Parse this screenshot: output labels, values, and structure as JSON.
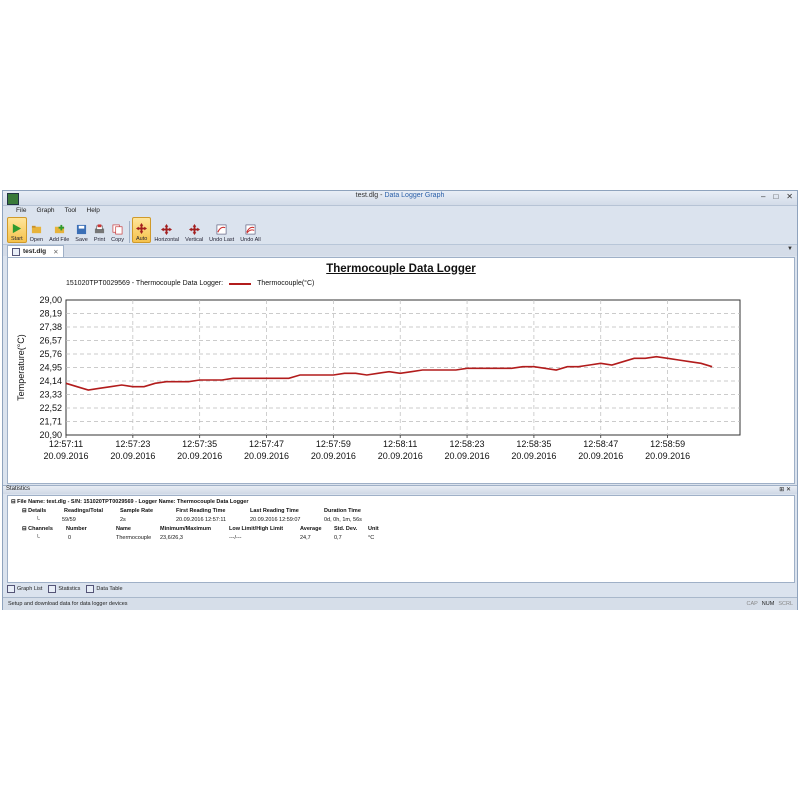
{
  "window": {
    "file_name": "test.dlg",
    "separator": " - ",
    "app_name": "Data Logger Graph",
    "controls": [
      "–",
      "□",
      "✕"
    ]
  },
  "menu": [
    "File",
    "Graph",
    "Tool",
    "Help"
  ],
  "toolbar": {
    "group1": [
      {
        "label": "Start",
        "icon": "play-icon"
      },
      {
        "label": "Open",
        "icon": "folder-open-icon"
      },
      {
        "label": "Add File",
        "icon": "add-file-icon"
      },
      {
        "label": "Save",
        "icon": "save-icon"
      },
      {
        "label": "Print",
        "icon": "print-icon"
      },
      {
        "label": "Copy",
        "icon": "copy-icon"
      }
    ],
    "group2": [
      {
        "label": "Auto",
        "icon": "move-auto-icon"
      },
      {
        "label": "Horizontal",
        "icon": "move-horizontal-icon"
      },
      {
        "label": "Vertical",
        "icon": "move-vertical-icon"
      },
      {
        "label": "Undo Last",
        "icon": "undo-last-icon"
      },
      {
        "label": "Undo All",
        "icon": "undo-all-icon"
      }
    ]
  },
  "document_tab": {
    "label": "test.dlg",
    "close": "✕"
  },
  "chart_data": {
    "type": "line",
    "title": "Thermocouple Data Logger",
    "subtitle": "151020TPT0029569 - Thermocouple Data Logger:",
    "legend": "Thermocouple(°C)",
    "ylabel": "Temperature(°C)",
    "xlabel": "",
    "ylim": [
      20.9,
      29.0
    ],
    "y_ticks": [
      "29,00",
      "28,19",
      "27,38",
      "26,57",
      "25,76",
      "24,95",
      "24,14",
      "23,33",
      "22,52",
      "21,71",
      "20,90"
    ],
    "x_ticks": [
      {
        "time": "12:57:11",
        "date": "20.09.2016"
      },
      {
        "time": "12:57:23",
        "date": "20.09.2016"
      },
      {
        "time": "12:57:35",
        "date": "20.09.2016"
      },
      {
        "time": "12:57:47",
        "date": "20.09.2016"
      },
      {
        "time": "12:57:59",
        "date": "20.09.2016"
      },
      {
        "time": "12:58:11",
        "date": "20.09.2016"
      },
      {
        "time": "12:58:23",
        "date": "20.09.2016"
      },
      {
        "time": "12:58:35",
        "date": "20.09.2016"
      },
      {
        "time": "12:58:47",
        "date": "20.09.2016"
      },
      {
        "time": "12:58:59",
        "date": "20.09.2016"
      }
    ],
    "xlim_seconds": [
      0,
      116
    ],
    "x_seconds": [
      0,
      2,
      4,
      6,
      8,
      10,
      12,
      14,
      16,
      18,
      20,
      22,
      24,
      26,
      28,
      30,
      32,
      34,
      36,
      38,
      40,
      42,
      44,
      46,
      48,
      50,
      52,
      54,
      56,
      58,
      60,
      62,
      64,
      66,
      68,
      70,
      72,
      74,
      76,
      78,
      80,
      82,
      84,
      86,
      88,
      90,
      92,
      94,
      96,
      98,
      100,
      102,
      104,
      106,
      108,
      110,
      112,
      114,
      116
    ],
    "values": [
      24.0,
      23.8,
      23.6,
      23.7,
      23.8,
      23.9,
      23.8,
      23.8,
      24.0,
      24.1,
      24.1,
      24.1,
      24.2,
      24.2,
      24.2,
      24.3,
      24.3,
      24.3,
      24.3,
      24.3,
      24.3,
      24.5,
      24.5,
      24.5,
      24.5,
      24.6,
      24.6,
      24.5,
      24.6,
      24.7,
      24.6,
      24.7,
      24.8,
      24.8,
      24.8,
      24.8,
      24.9,
      24.9,
      24.9,
      24.9,
      24.9,
      25.0,
      25.0,
      24.9,
      24.8,
      25.0,
      25.0,
      25.1,
      25.2,
      25.1,
      25.3,
      25.5,
      25.5,
      25.6,
      25.5,
      25.4,
      25.3,
      25.2,
      25.0
    ],
    "grid": true,
    "line_color": "#b21c1c"
  },
  "stats_panel": {
    "title": "Statistics",
    "pin": "⊞ ✕",
    "file_line": "File Name: test.dlg - S/N: 151020TPT0029569 - Logger Name: Thermocouple Data Logger",
    "details_label": "Details",
    "details_headers": [
      "Readings/Total",
      "Sample Rate",
      "First Reading Time",
      "Last Reading Time",
      "Duration Time"
    ],
    "details_values": [
      "59/59",
      "2s",
      "20.09.2016 12:57:11",
      "20.09.2016 12:59:07",
      "0d, 0h, 1m, 56s"
    ],
    "channels_label": "Channels",
    "channels_headers": [
      "Number",
      "Name",
      "Minimum/Maximum",
      "Low Limit/High Limit",
      "Average",
      "Std. Dev.",
      "Unit"
    ],
    "channels_values": [
      "0",
      "Thermocouple",
      "23,6/26,3",
      "---/---",
      "24,7",
      "0,7",
      "°C"
    ]
  },
  "bottom_tabs": [
    "Graph List",
    "Statistics",
    "Data Table"
  ],
  "status": {
    "text": "Setup and download data for data logger devices",
    "indicators": [
      "CAP",
      "NUM",
      "SCRL"
    ]
  },
  "colors": {
    "accent": "#f5c24c",
    "series": "#b21c1c",
    "chrome": "#dbe3ee"
  }
}
